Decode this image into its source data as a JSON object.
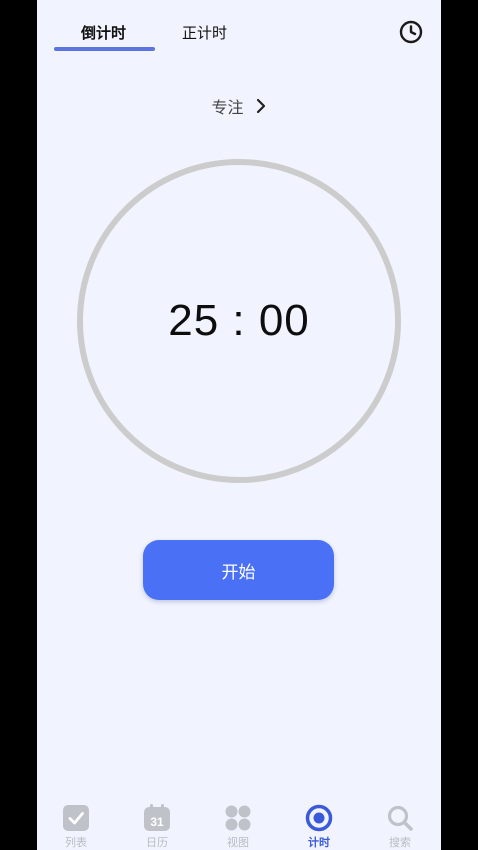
{
  "tabs": {
    "countdown": "倒计时",
    "countup": "正计时",
    "active": "countdown"
  },
  "mode": {
    "label": "专注"
  },
  "timer": {
    "display": "25 : 00"
  },
  "controls": {
    "start_label": "开始"
  },
  "bottom_nav": {
    "items": [
      {
        "label": "列表",
        "icon": "checkbox-icon"
      },
      {
        "label": "日历",
        "icon": "calendar-icon",
        "badge": "31"
      },
      {
        "label": "视图",
        "icon": "grid-icon"
      },
      {
        "label": "计时",
        "icon": "timer-icon",
        "active": true
      },
      {
        "label": "搜索",
        "icon": "search-icon"
      }
    ]
  },
  "colors": {
    "accent": "#4a70f5",
    "tab_indicator": "#5b74e0",
    "background": "#f1f4fe",
    "ring": "#cccccc",
    "nav_inactive": "#b9bbc3",
    "nav_active": "#3a5ad9"
  }
}
